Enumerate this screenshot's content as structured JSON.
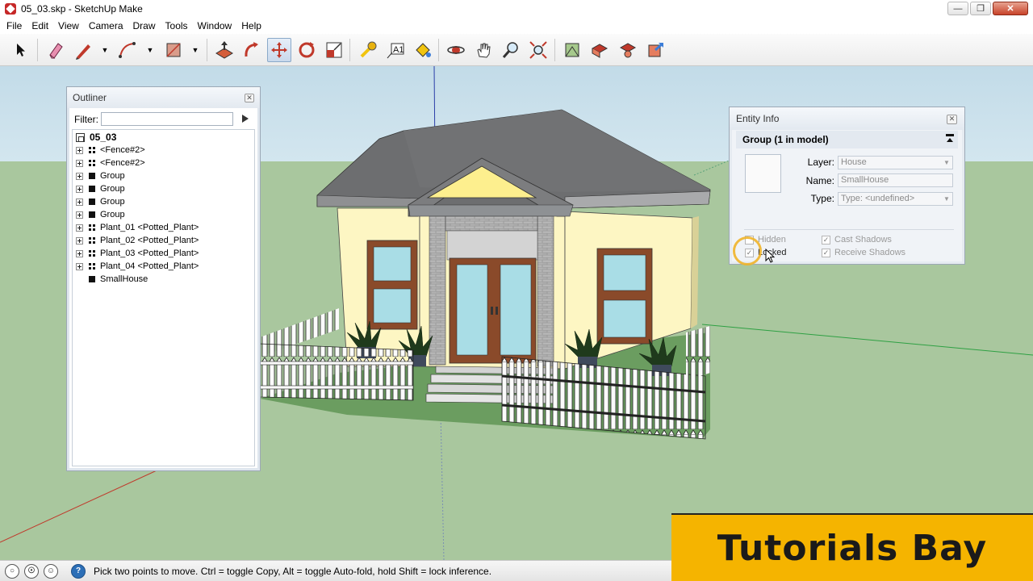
{
  "window": {
    "title": "05_03.skp - SketchUp Make",
    "icon": "sketchup-logo-icon"
  },
  "menu": [
    "File",
    "Edit",
    "View",
    "Camera",
    "Draw",
    "Tools",
    "Window",
    "Help"
  ],
  "toolbar": {
    "tools": [
      "select-icon",
      "eraser-icon",
      "pencil-line-icon",
      "arc-icon",
      "rectangle-icon",
      "push-pull-icon",
      "follow-me-icon",
      "move-icon",
      "rotate-icon",
      "scale-icon",
      "tape-measure-icon",
      "text-icon",
      "paint-bucket-icon",
      "orbit-icon",
      "pan-icon",
      "zoom-icon",
      "zoom-extents-icon",
      "3d-warehouse-icon",
      "components-icon",
      "extension-warehouse-icon",
      "share-model-icon"
    ],
    "active_tool": "move-icon"
  },
  "outliner": {
    "title": "Outliner",
    "filter_label": "Filter:",
    "filter_value": "",
    "root": "05_03",
    "items": [
      {
        "label": "<Fence#2>",
        "type": "component"
      },
      {
        "label": "<Fence#2>",
        "type": "component"
      },
      {
        "label": "Group",
        "type": "group"
      },
      {
        "label": "Group",
        "type": "group"
      },
      {
        "label": "Group",
        "type": "group"
      },
      {
        "label": "Group",
        "type": "group"
      },
      {
        "label": "Plant_01 <Potted_Plant>",
        "type": "component"
      },
      {
        "label": "Plant_02 <Potted_Plant>",
        "type": "component"
      },
      {
        "label": "Plant_03 <Potted_Plant>",
        "type": "component"
      },
      {
        "label": "Plant_04 <Potted_Plant>",
        "type": "component"
      },
      {
        "label": "SmallHouse",
        "type": "group"
      }
    ]
  },
  "entity_info": {
    "title": "Entity Info",
    "header": "Group (1 in model)",
    "layer_label": "Layer:",
    "layer_value": "House",
    "name_label": "Name:",
    "name_value": "SmallHouse",
    "type_label": "Type:",
    "type_value": "Type: <undefined>",
    "hidden_label": "Hidden",
    "locked_label": "Locked",
    "cast_shadows_label": "Cast Shadows",
    "receive_shadows_label": "Receive Shadows",
    "hidden_checked": false,
    "locked_checked": true,
    "cast_shadows_checked": true,
    "receive_shadows_checked": true
  },
  "status": {
    "message": "Pick two points to move.  Ctrl = toggle Copy, Alt = toggle Auto-fold, hold Shift = lock inference."
  },
  "watermark": {
    "text": "Tutorials Bay"
  },
  "colors": {
    "sky": "#c6dde9",
    "ground": "#a9c79e",
    "wall": "#fdf7c5",
    "roof": "#6d6e70",
    "watermark": "#f5b400"
  }
}
